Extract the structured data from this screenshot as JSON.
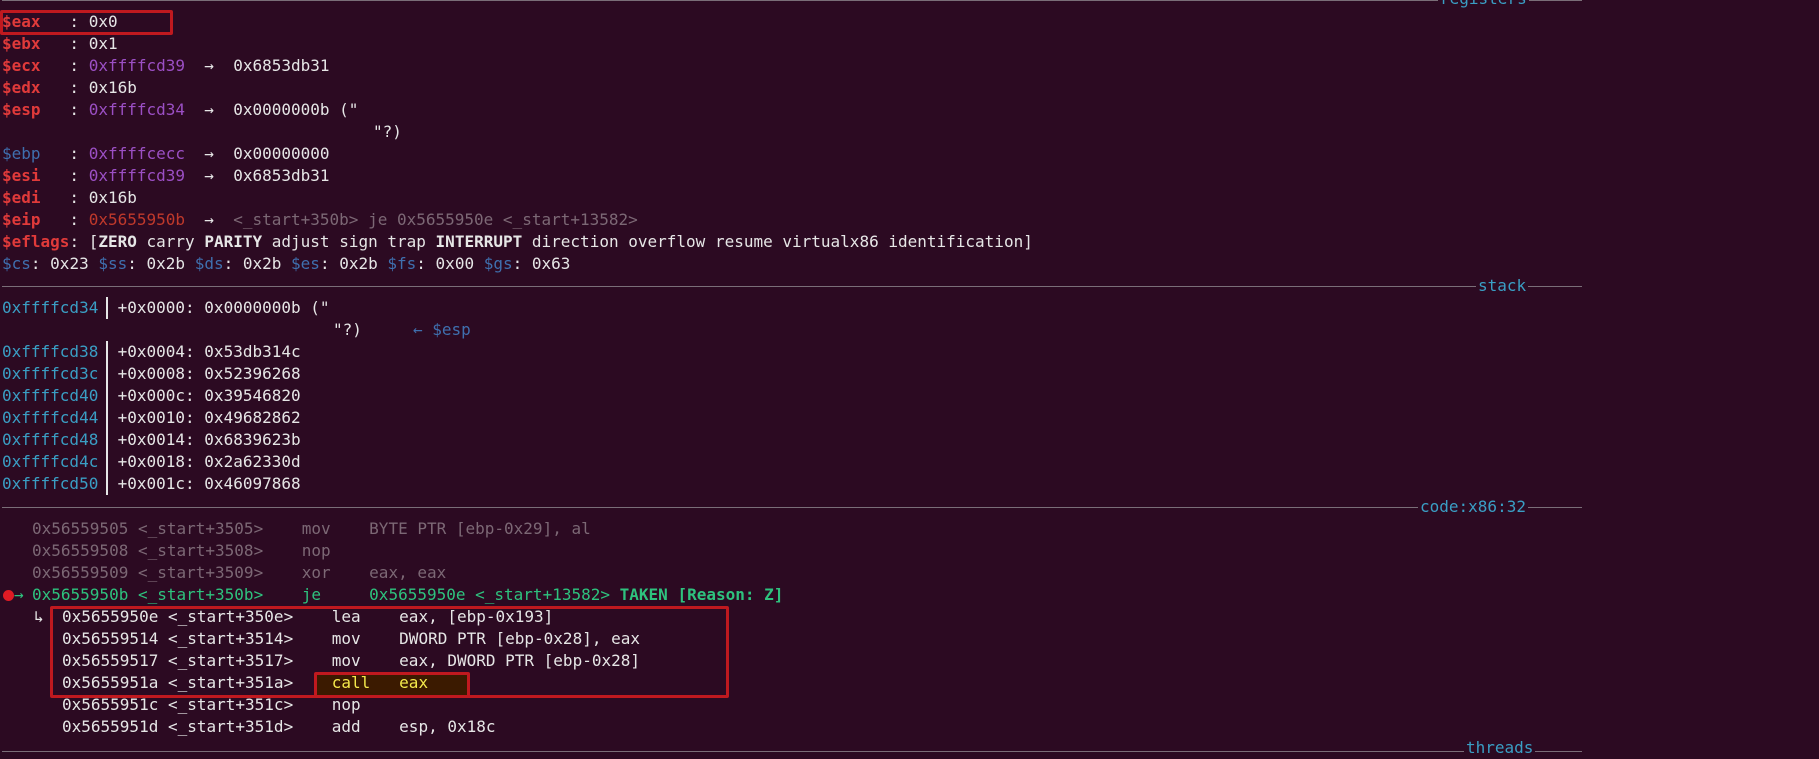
{
  "sections": {
    "registers": "registers",
    "stack": "stack",
    "code": "code:x86:32",
    "threads": "threads"
  },
  "arrow": "→",
  "registers": {
    "eax": {
      "name": "$eax",
      "colon": "   : ",
      "val": "0x0"
    },
    "ebx": {
      "name": "$ebx",
      "colon": "   : ",
      "val": "0x1"
    },
    "ecx": {
      "name": "$ecx",
      "colon": "   : ",
      "val": "0xffffcd39",
      "deref": "0x6853db31"
    },
    "edx": {
      "name": "$edx",
      "colon": "   : ",
      "val": "0x16b"
    },
    "esp": {
      "name": "$esp",
      "colon": "   : ",
      "val": "0xffffcd34",
      "deref": "0x0000000b (\"",
      "cont": "\"?)"
    },
    "ebp": {
      "name": "$ebp",
      "colon": "   : ",
      "val": "0xffffcecc",
      "deref": "0x00000000"
    },
    "esi": {
      "name": "$esi",
      "colon": "   : ",
      "val": "0xffffcd39",
      "deref": "0x6853db31"
    },
    "edi": {
      "name": "$edi",
      "colon": "   : ",
      "val": "0x16b"
    },
    "eip": {
      "name": "$eip",
      "colon": "   : ",
      "val": "0x5655950b",
      "deref": "<_start+350b> je 0x5655950e <_start+13582>"
    },
    "eflags": {
      "name": "$eflags",
      "open": ": [",
      "flags": [
        "ZERO",
        "carry",
        "PARITY",
        "adjust",
        "sign",
        "trap",
        "INTERRUPT",
        "direction",
        "overflow",
        "resume",
        "virtualx86",
        "identification"
      ],
      "close": "]"
    },
    "segments": [
      {
        "name": "$cs",
        "val": "0x23"
      },
      {
        "name": "$ss",
        "val": "0x2b"
      },
      {
        "name": "$ds",
        "val": "0x2b"
      },
      {
        "name": "$es",
        "val": "0x2b"
      },
      {
        "name": "$fs",
        "val": "0x00"
      },
      {
        "name": "$gs",
        "val": "0x63"
      }
    ]
  },
  "stack": {
    "esp_marker": "← $esp",
    "rows": [
      {
        "addr": "0xffffcd34",
        "off": "+0x0000:",
        "val": "0x0000000b (\"",
        "cont": "\"?)"
      },
      {
        "addr": "0xffffcd38",
        "off": "+0x0004:",
        "val": "0x53db314c"
      },
      {
        "addr": "0xffffcd3c",
        "off": "+0x0008:",
        "val": "0x52396268"
      },
      {
        "addr": "0xffffcd40",
        "off": "+0x000c:",
        "val": "0x39546820"
      },
      {
        "addr": "0xffffcd44",
        "off": "+0x0010:",
        "val": "0x49682862"
      },
      {
        "addr": "0xffffcd48",
        "off": "+0x0014:",
        "val": "0x6839623b"
      },
      {
        "addr": "0xffffcd4c",
        "off": "+0x0018:",
        "val": "0x2a62330d"
      },
      {
        "addr": "0xffffcd50",
        "off": "+0x001c:",
        "val": "0x46097868"
      }
    ]
  },
  "code": {
    "branch_arrow": "↳",
    "rows": [
      {
        "addr": "0x56559505",
        "sym": "<_start+3505>",
        "mn": "mov",
        "ops": "BYTE PTR [ebp-0x29], al"
      },
      {
        "addr": "0x56559508",
        "sym": "<_start+3508>",
        "mn": "nop",
        "ops": ""
      },
      {
        "addr": "0x56559509",
        "sym": "<_start+3509>",
        "mn": "xor",
        "ops": "eax, eax"
      },
      {
        "addr": "0x5655950b",
        "sym": "<_start+350b>",
        "mn": "je",
        "ops": "0x5655950e <_start+13582>",
        "taken": "TAKEN [Reason: Z]"
      },
      {
        "addr": "0x5655950e",
        "sym": "<_start+350e>",
        "mn": "lea",
        "ops": "eax, [ebp-0x193]"
      },
      {
        "addr": "0x56559514",
        "sym": "<_start+3514>",
        "mn": "mov",
        "ops": "DWORD PTR [ebp-0x28], eax"
      },
      {
        "addr": "0x56559517",
        "sym": "<_start+3517>",
        "mn": "mov",
        "ops": "eax, DWORD PTR [ebp-0x28]"
      },
      {
        "addr": "0x5655951a",
        "sym": "<_start+351a>",
        "mn": "call",
        "ops": "eax"
      },
      {
        "addr": "0x5655951c",
        "sym": "<_start+351c>",
        "mn": "nop",
        "ops": ""
      },
      {
        "addr": "0x5655951d",
        "sym": "<_start+351d>",
        "mn": "add",
        "ops": "esp, 0x18c"
      }
    ]
  }
}
